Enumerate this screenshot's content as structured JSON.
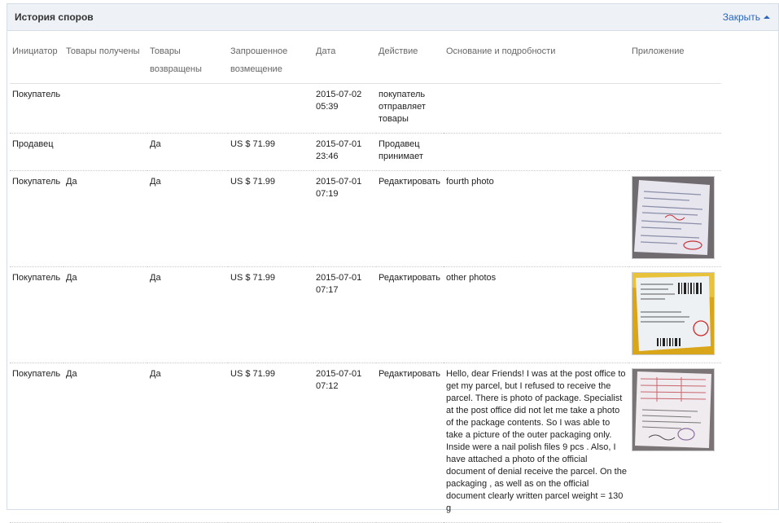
{
  "panel": {
    "title": "История споров",
    "close_label": "Закрыть"
  },
  "columns": [
    "Инициатор",
    "Товары получены",
    "Товары возвращены",
    "Запрошенное возмещение",
    "Дата",
    "Действие",
    "Основание и подробности",
    "Приложение"
  ],
  "rows": [
    {
      "initiator": "Покупатель",
      "received": "",
      "returned": "",
      "refund": "",
      "date": "2015-07-02 05:39",
      "action": "покупатель отправляет товары",
      "reason": "",
      "attachment": ""
    },
    {
      "initiator": "Продавец",
      "received": "",
      "returned": "Да",
      "refund": "US $ 71.99",
      "date": "2015-07-01 23:46",
      "action": "Продавец принимает",
      "reason": "",
      "attachment": ""
    },
    {
      "initiator": "Покупатель",
      "received": "Да",
      "returned": "Да",
      "refund": "US $ 71.99",
      "date": "2015-07-01 07:19",
      "action": "Редактировать",
      "reason": "fourth photo",
      "attachment": "document-photo-thumbnail"
    },
    {
      "initiator": "Покупатель",
      "received": "Да",
      "returned": "Да",
      "refund": "US $ 71.99",
      "date": "2015-07-01 07:17",
      "action": "Редактировать",
      "reason": "other photos",
      "attachment": "package-photo-thumbnail"
    },
    {
      "initiator": "Покупатель",
      "received": "Да",
      "returned": "Да",
      "refund": "US $ 71.99",
      "date": "2015-07-01 07:12",
      "action": "Редактировать",
      "reason": "Hello, dear Friends! I was at the post office to get my parcel, but I refused to receive the parcel. There is photo of package. Specialist at the post office did not let me take a photo of the package contents. So I was able to take a picture of the outer packaging only. Inside were a nail polish files 9 pcs . Also, I have attached a photo of the official document of denial receive the parcel. On the packaging , as well as on the official document clearly written parcel weight = 130 g",
      "attachment": "form-photo-thumbnail"
    }
  ]
}
